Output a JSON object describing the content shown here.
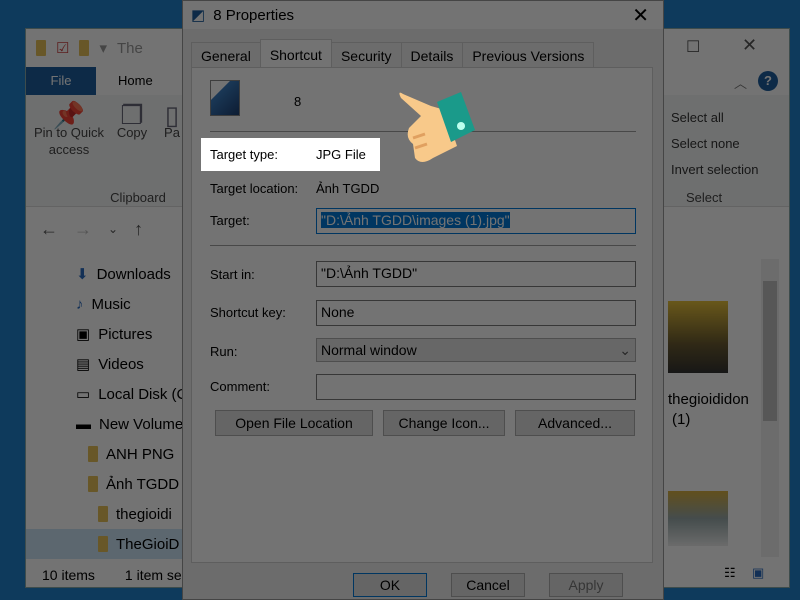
{
  "explorer": {
    "title_partial": "The",
    "ribbon_tabs": [
      "File",
      "Home"
    ],
    "clipboard": {
      "pin": "Pin to Quick access",
      "copy": "Copy",
      "paste_partial": "Pa",
      "group": "Clipboard"
    },
    "select": {
      "select_all": "Select all",
      "select_none": "Select none",
      "invert": "Invert selection",
      "group": "Select"
    },
    "nav_items": [
      "Downloads",
      "Music",
      "Pictures",
      "Videos",
      "Local Disk (C",
      "New Volume",
      "ANH PNG",
      "Ảnh TGDD",
      "thegioidi",
      "TheGioiD"
    ],
    "file_label": "thegioididon",
    "file_label2": "(1)",
    "status": {
      "count": "10 items",
      "selected": "1 item se"
    }
  },
  "dialog": {
    "title": "8 Properties",
    "tabs": [
      "General",
      "Shortcut",
      "Security",
      "Details",
      "Previous Versions"
    ],
    "active_tab": "Shortcut",
    "name": "8",
    "target_type_label": "Target type:",
    "target_type": "JPG File",
    "target_location_label": "Target location:",
    "target_location": "Ảnh TGDD",
    "target_label": "Target:",
    "target": "\"D:\\Ảnh TGDD\\images (1).jpg\"",
    "start_in_label": "Start in:",
    "start_in": "\"D:\\Ảnh TGDD\"",
    "shortcut_key_label": "Shortcut key:",
    "shortcut_key": "None",
    "run_label": "Run:",
    "run": "Normal window",
    "comment_label": "Comment:",
    "comment": "",
    "buttons": {
      "open_location": "Open File Location",
      "change_icon": "Change Icon...",
      "advanced": "Advanced...",
      "ok": "OK",
      "cancel": "Cancel",
      "apply": "Apply"
    }
  },
  "colors": {
    "accent": "#1c5e9e",
    "selection": "#0078d7",
    "hand": "#f8c98a",
    "cuff": "#1a9a8a"
  }
}
